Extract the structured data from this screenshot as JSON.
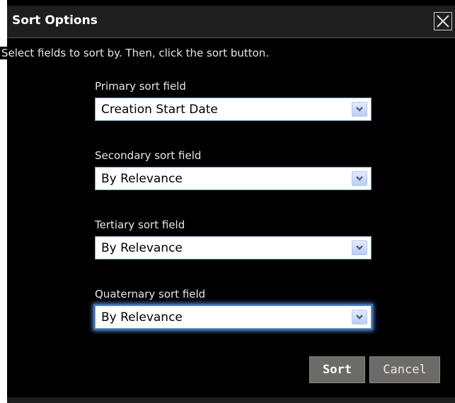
{
  "dialog": {
    "title": "Sort Options",
    "instructions": "Select fields to sort by. Then, click the sort button.",
    "fields": [
      {
        "label": "Primary sort field",
        "value": "Creation Start Date"
      },
      {
        "label": "Secondary sort field",
        "value": "By Relevance"
      },
      {
        "label": "Tertiary sort field",
        "value": "By Relevance"
      },
      {
        "label": "Quaternary sort field",
        "value": "By Relevance"
      }
    ],
    "buttons": {
      "sort": "Sort",
      "cancel": "Cancel"
    }
  },
  "icons": {
    "close": "close-icon",
    "dropdown": "chevron-down-icon"
  },
  "colors": {
    "background": "#000000",
    "titlebar": "#1e1e1e",
    "button": "#6d6b68",
    "focus": "#3d6fb6"
  }
}
